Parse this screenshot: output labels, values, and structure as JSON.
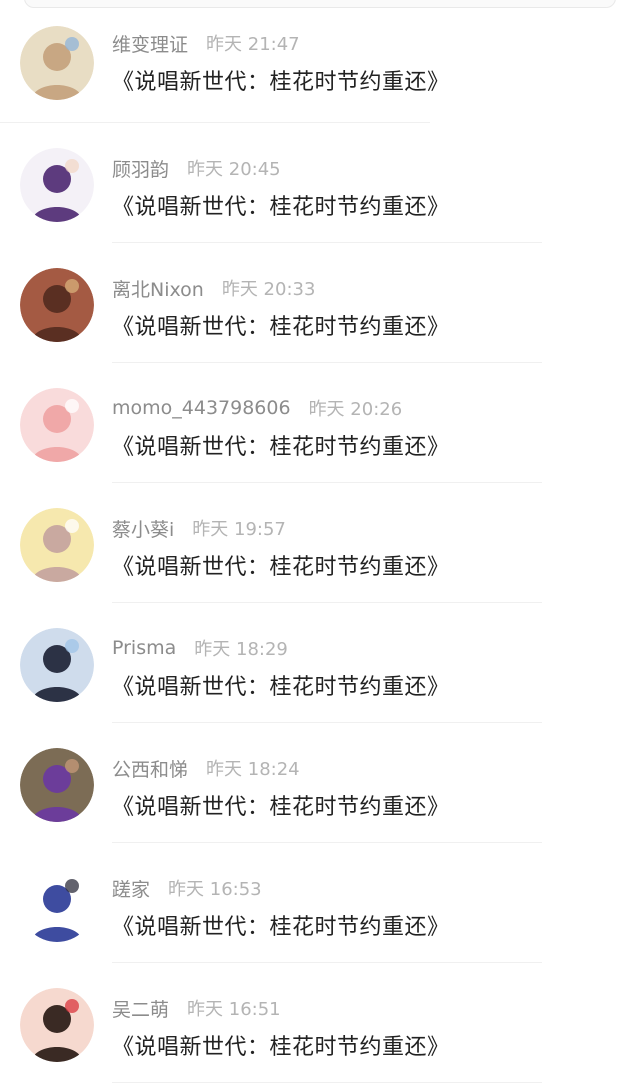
{
  "comments": [
    {
      "user": "维变理证",
      "time": "昨天 21:47",
      "text": "《说唱新世代：桂花时节约重还》",
      "avatar": {
        "bg": "#e8ddc4",
        "fg": "#c8a783",
        "accent": "#8fb3d9"
      }
    },
    {
      "user": "顾羽韵",
      "time": "昨天 20:45",
      "text": "《说唱新世代：桂花时节约重还》",
      "avatar": {
        "bg": "#f4f1f7",
        "fg": "#5d3b7e",
        "accent": "#f3d7c7"
      }
    },
    {
      "user": "离北Nixon",
      "time": "昨天 20:33",
      "text": "《说唱新世代：桂花时节约重还》",
      "avatar": {
        "bg": "#a45a43",
        "fg": "#5a2f22",
        "accent": "#d8b07a"
      }
    },
    {
      "user": "momo_443798606",
      "time": "昨天 20:26",
      "text": "《说唱新世代：桂花时节约重还》",
      "avatar": {
        "bg": "#f9dbdb",
        "fg": "#f0a8a8",
        "accent": "#ffffff"
      }
    },
    {
      "user": "蔡小葵i",
      "time": "昨天 19:57",
      "text": "《说唱新世代：桂花时节约重还》",
      "avatar": {
        "bg": "#f6e8ae",
        "fg": "#c9a9a0",
        "accent": "#ffffff"
      }
    },
    {
      "user": "Prisma",
      "time": "昨天 18:29",
      "text": "《说唱新世代：桂花时节约重还》",
      "avatar": {
        "bg": "#cfdcec",
        "fg": "#2c3245",
        "accent": "#9fc4e8"
      }
    },
    {
      "user": "公西和悌",
      "time": "昨天 18:24",
      "text": "《说唱新世代：桂花时节约重还》",
      "avatar": {
        "bg": "#7c6c55",
        "fg": "#6c3d9a",
        "accent": "#c79a7a"
      }
    },
    {
      "user": "蹉家",
      "time": "昨天 16:53",
      "text": "《说唱新世代：桂花时节约重还》",
      "avatar": {
        "bg": "#ffffff",
        "fg": "#3e4ca0",
        "accent": "#2e2e3c"
      }
    },
    {
      "user": "吴二萌",
      "time": "昨天 16:51",
      "text": "《说唱新世代：桂花时节约重还》",
      "avatar": {
        "bg": "#f6d9cf",
        "fg": "#3a2a24",
        "accent": "#d9363e"
      }
    }
  ]
}
